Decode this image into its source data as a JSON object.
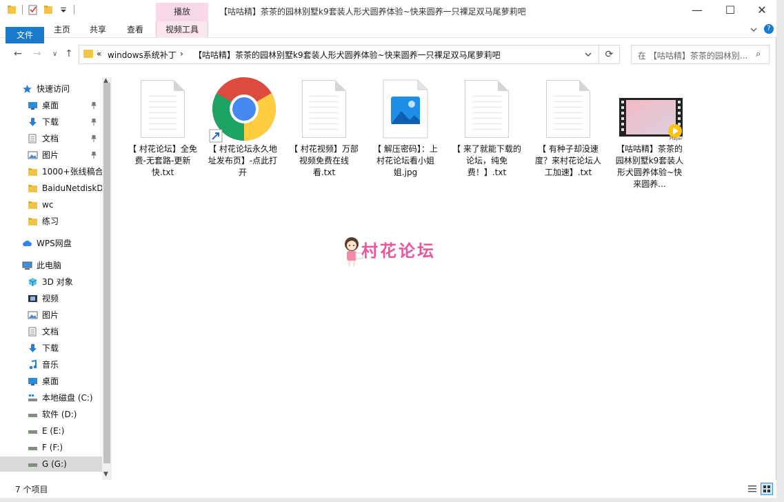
{
  "window": {
    "title": "【咕咕精】茶茶的园林别墅k9套装人形犬圆养体验~快来圆养一只裸足双马尾萝莉吧",
    "context_tab": "播放",
    "controls": {
      "minimize": "—",
      "maximize": "☐",
      "close": "✕"
    }
  },
  "ribbon": {
    "tabs": [
      "文件",
      "主页",
      "共享",
      "查看",
      "视频工具"
    ],
    "help": "?"
  },
  "address": {
    "back": "←",
    "forward": "→",
    "history": "∨",
    "up": "↑",
    "overflow": "«",
    "segments": [
      "windows系统补丁",
      "【咕咕精】茶茶的园林别墅k9套装人形犬圆养体验~快来圆养一只裸足双马尾萝莉吧"
    ],
    "separator": "›",
    "refresh": "⟳",
    "search_placeholder": "在 【咕咕精】茶茶的园林别...",
    "search_icon": "⌕"
  },
  "navigation": {
    "items": [
      {
        "label": "快速访问",
        "icon": "star-icon",
        "level": 0,
        "pinned": false
      },
      {
        "label": "桌面",
        "icon": "desktop-icon",
        "level": 1,
        "pinned": true
      },
      {
        "label": "下载",
        "icon": "download-icon",
        "level": 1,
        "pinned": true
      },
      {
        "label": "文档",
        "icon": "document-icon",
        "level": 1,
        "pinned": true
      },
      {
        "label": "图片",
        "icon": "picture-icon",
        "level": 1,
        "pinned": true
      },
      {
        "label": "1000+张线稿合",
        "icon": "folder-icon",
        "level": 1,
        "pinned": false
      },
      {
        "label": "BaiduNetdiskD",
        "icon": "folder-icon",
        "level": 1,
        "pinned": false
      },
      {
        "label": "wc",
        "icon": "folder-icon",
        "level": 1,
        "pinned": false
      },
      {
        "label": "练习",
        "icon": "folder-icon",
        "level": 1,
        "pinned": false
      },
      {
        "label": "WPS网盘",
        "icon": "cloud-icon",
        "level": 0,
        "pinned": false
      },
      {
        "label": "此电脑",
        "icon": "computer-icon",
        "level": 0,
        "pinned": false
      },
      {
        "label": "3D 对象",
        "icon": "cube-icon",
        "level": 1,
        "pinned": false
      },
      {
        "label": "视频",
        "icon": "video-icon",
        "level": 1,
        "pinned": false
      },
      {
        "label": "图片",
        "icon": "picture-icon",
        "level": 1,
        "pinned": false
      },
      {
        "label": "文档",
        "icon": "document-icon",
        "level": 1,
        "pinned": false
      },
      {
        "label": "下载",
        "icon": "download-icon",
        "level": 1,
        "pinned": false
      },
      {
        "label": "音乐",
        "icon": "music-icon",
        "level": 1,
        "pinned": false
      },
      {
        "label": "桌面",
        "icon": "desktop-icon",
        "level": 1,
        "pinned": false
      },
      {
        "label": "本地磁盘 (C:)",
        "icon": "system-drive-icon",
        "level": 1,
        "pinned": false
      },
      {
        "label": "软件 (D:)",
        "icon": "drive-icon",
        "level": 1,
        "pinned": false
      },
      {
        "label": "E (E:)",
        "icon": "drive-icon",
        "level": 1,
        "pinned": false
      },
      {
        "label": "F (F:)",
        "icon": "drive-icon",
        "level": 1,
        "pinned": false
      },
      {
        "label": "G (G:)",
        "icon": "drive-icon",
        "level": 1,
        "pinned": false,
        "selected": true
      }
    ],
    "pin_glyph": "📌"
  },
  "files": [
    {
      "name": "【 村花论坛】全免费-无套路-更新快.txt",
      "icon": "text-file-icon"
    },
    {
      "name": "【 村花论坛永久地址发布页】-点此打开",
      "icon": "chrome-shortcut-icon"
    },
    {
      "name": "【 村花视频】万部视频免费在线看.txt",
      "icon": "text-file-icon"
    },
    {
      "name": "【 解压密码】：上村花论坛看小姐姐.jpg",
      "icon": "image-file-icon"
    },
    {
      "name": "【 来了就能下载的论坛，纯免费！】.txt",
      "icon": "text-file-icon"
    },
    {
      "name": "【 有种子却没速度？来村花论坛人工加速】.txt",
      "icon": "text-file-icon"
    },
    {
      "name": "【咕咕精】茶茶的园林别墅k9套装人形犬圆养体验~快来圆养...",
      "icon": "video-file-icon",
      "badge": "Player"
    }
  ],
  "watermark": {
    "text": "村花论坛"
  },
  "status": {
    "count": "7 个项目"
  },
  "colors": {
    "accent": "#1979ca",
    "context": "#f9d9e8",
    "folder": "#f4c445",
    "watermark": "#e7589c"
  }
}
